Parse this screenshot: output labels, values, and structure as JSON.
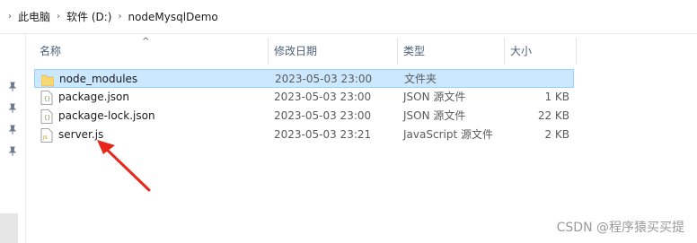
{
  "breadcrumb": {
    "items": [
      "此电脑",
      "软件 (D:)",
      "nodeMysqlDemo"
    ],
    "separator": "›"
  },
  "columns": {
    "name": "名称",
    "date": "修改日期",
    "type": "类型",
    "size": "大小"
  },
  "files": [
    {
      "name": "node_modules",
      "date": "2023-05-03 23:00",
      "type": "文件夹",
      "size": "",
      "icon": "folder-icon",
      "selected": true
    },
    {
      "name": "package.json",
      "date": "2023-05-03 23:00",
      "type": "JSON 源文件",
      "size": "1 KB",
      "icon": "json-file-icon",
      "selected": false
    },
    {
      "name": "package-lock.json",
      "date": "2023-05-03 23:00",
      "type": "JSON 源文件",
      "size": "22 KB",
      "icon": "json-file-icon",
      "selected": false
    },
    {
      "name": "server.js",
      "date": "2023-05-03 23:21",
      "type": "JavaScript 源文件",
      "size": "2 KB",
      "icon": "js-file-icon",
      "selected": false
    }
  ],
  "watermark": "CSDN @程序猿买买提",
  "colors": {
    "selection_bg": "#cce8ff",
    "selection_border": "#99d1ff",
    "header_text": "#4c607a",
    "folder": "#f8d775",
    "annotation_arrow": "#e8271c"
  }
}
